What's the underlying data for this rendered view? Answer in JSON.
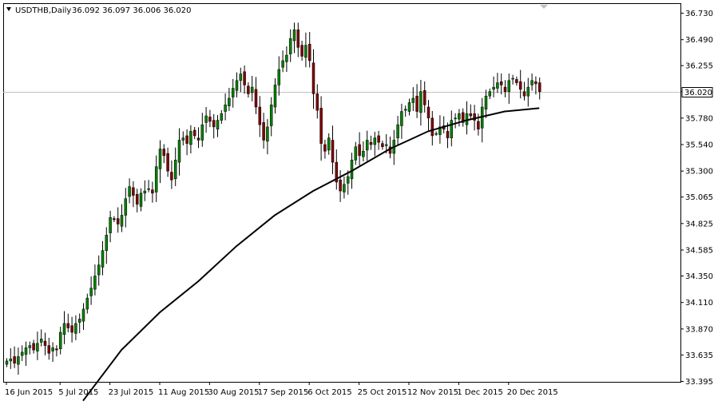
{
  "header": {
    "symbol": "USDTHB,Daily",
    "ohlc": "36.092 36.097 36.006 36.020",
    "current_price_label": "36.020"
  },
  "chart_data": {
    "type": "candlestick",
    "title": "USDTHB,Daily",
    "ylim": [
      33.395,
      36.8
    ],
    "y_ticks": [
      36.73,
      36.49,
      36.255,
      36.02,
      35.78,
      35.54,
      35.3,
      35.065,
      34.825,
      34.585,
      34.35,
      34.11,
      33.87,
      33.635,
      33.395
    ],
    "y_tick_labels": [
      "36.730",
      "36.490",
      "36.255",
      "36.020",
      "35.780",
      "35.540",
      "35.300",
      "35.065",
      "34.825",
      "34.585",
      "34.350",
      "34.110",
      "33.870",
      "33.635",
      "33.395"
    ],
    "x_labels": [
      {
        "label": "16 Jun 2015",
        "index": 0
      },
      {
        "label": "5 Jul 2015",
        "index": 14
      },
      {
        "label": "23 Jul 2015",
        "index": 27
      },
      {
        "label": "11 Aug 2015",
        "index": 40
      },
      {
        "label": "30 Aug 2015",
        "index": 53
      },
      {
        "label": "17 Sep 2015",
        "index": 66
      },
      {
        "label": "6 Oct 2015",
        "index": 79
      },
      {
        "label": "25 Oct 2015",
        "index": 92
      },
      {
        "label": "12 Nov 2015",
        "index": 105
      },
      {
        "label": "1 Dec 2015",
        "index": 118
      },
      {
        "label": "20 Dec 2015",
        "index": 131
      }
    ],
    "current_price": 36.02,
    "closes": [
      33.58,
      33.6,
      33.56,
      33.62,
      33.66,
      33.7,
      33.72,
      33.68,
      33.74,
      33.78,
      33.72,
      33.65,
      33.7,
      33.68,
      33.84,
      33.92,
      33.88,
      33.84,
      33.92,
      33.96,
      34.05,
      34.15,
      34.24,
      34.35,
      34.45,
      34.58,
      34.72,
      34.88,
      34.86,
      34.82,
      34.9,
      35.05,
      35.16,
      35.08,
      35.0,
      35.1,
      35.12,
      35.14,
      35.1,
      35.34,
      35.5,
      35.44,
      35.3,
      35.22,
      35.4,
      35.58,
      35.6,
      35.55,
      35.66,
      35.62,
      35.58,
      35.72,
      35.8,
      35.75,
      35.7,
      35.76,
      35.82,
      35.9,
      35.96,
      36.05,
      36.12,
      36.18,
      36.08,
      36.0,
      36.06,
      35.88,
      35.72,
      35.58,
      35.7,
      35.9,
      36.08,
      36.22,
      36.3,
      36.35,
      36.5,
      36.58,
      36.42,
      36.34,
      36.44,
      36.3,
      36.0,
      35.85,
      35.55,
      35.48,
      35.6,
      35.38,
      35.2,
      35.12,
      35.18,
      35.25,
      35.4,
      35.52,
      35.44,
      35.48,
      35.58,
      35.54,
      35.6,
      35.56,
      35.52,
      35.54,
      35.46,
      35.58,
      35.72,
      35.84,
      35.86,
      35.92,
      35.96,
      35.84,
      36.02,
      35.9,
      35.78,
      35.62,
      35.64,
      35.7,
      35.68,
      35.6,
      35.76,
      35.78,
      35.82,
      35.74,
      35.82,
      35.8,
      35.76,
      35.68,
      35.88,
      35.98,
      36.02,
      36.06,
      36.1,
      36.08,
      36.02,
      36.12,
      36.14,
      36.1,
      36.04,
      35.98,
      36.06,
      36.12,
      36.09,
      36.02
    ],
    "sma": [
      {
        "i": 20,
        "v": 33.22
      },
      {
        "i": 30,
        "v": 33.68
      },
      {
        "i": 40,
        "v": 34.02
      },
      {
        "i": 50,
        "v": 34.3
      },
      {
        "i": 60,
        "v": 34.62
      },
      {
        "i": 70,
        "v": 34.9
      },
      {
        "i": 80,
        "v": 35.12
      },
      {
        "i": 90,
        "v": 35.3
      },
      {
        "i": 100,
        "v": 35.5
      },
      {
        "i": 110,
        "v": 35.66
      },
      {
        "i": 120,
        "v": 35.76
      },
      {
        "i": 130,
        "v": 35.84
      },
      {
        "i": 139,
        "v": 35.87
      }
    ],
    "colors": {
      "up": "#008000",
      "down": "#800000",
      "sma": "#000000",
      "price_line": "#c0c0c0",
      "grid_border": "#000000"
    },
    "grid": false
  }
}
